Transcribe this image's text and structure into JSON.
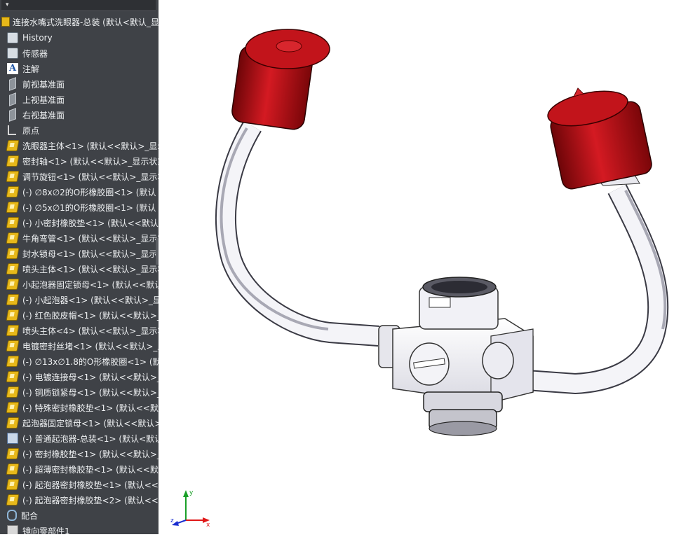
{
  "feature_tree": {
    "root_label": "连接水嘴式洗眼器-总装 (默认<默认_显示",
    "items": [
      {
        "label": "History",
        "icon": "history-icon"
      },
      {
        "label": "传感器",
        "icon": "sensor-icon"
      },
      {
        "label": "注解",
        "icon": "annotation-icon"
      },
      {
        "label": "前视基准面",
        "icon": "plane-icon"
      },
      {
        "label": "上视基准面",
        "icon": "plane-icon"
      },
      {
        "label": "右视基准面",
        "icon": "plane-icon"
      },
      {
        "label": "原点",
        "icon": "origin-icon"
      },
      {
        "label": "洗眼器主体<1> (默认<<默认>_显示",
        "icon": "part-icon"
      },
      {
        "label": "密封轴<1> (默认<<默认>_显示状态",
        "icon": "part-icon"
      },
      {
        "label": "调节旋钮<1> (默认<<默认>_显示状",
        "icon": "part-icon"
      },
      {
        "label": "(-) ∅8x∅2的O形橡胶圈<1> (默认",
        "icon": "part-icon"
      },
      {
        "label": "(-) ∅5x∅1的O形橡胶圈<1> (默认",
        "icon": "part-icon"
      },
      {
        "label": "(-) 小密封橡胶垫<1> (默认<<默认",
        "icon": "part-icon"
      },
      {
        "label": "牛角弯管<1> (默认<<默认>_显示状",
        "icon": "part-icon"
      },
      {
        "label": "封水锁母<1> (默认<<默认>_显示状",
        "icon": "part-icon"
      },
      {
        "label": "喷头主体<1> (默认<<默认>_显示状",
        "icon": "part-icon"
      },
      {
        "label": "小起泡器固定锁母<1> (默认<<默认",
        "icon": "part-icon"
      },
      {
        "label": "(-) 小起泡器<1> (默认<<默认>_显",
        "icon": "part-icon"
      },
      {
        "label": "(-) 红色胶皮帽<1> (默认<<默认>_",
        "icon": "part-icon"
      },
      {
        "label": "喷头主体<4> (默认<<默认>_显示状",
        "icon": "part-icon"
      },
      {
        "label": "电镀密封丝堵<1> (默认<<默认>_显",
        "icon": "part-icon"
      },
      {
        "label": "(-) ∅13x∅1.8的O形橡胶圈<1> (默",
        "icon": "part-icon"
      },
      {
        "label": "(-) 电镀连接母<1> (默认<<默认>_",
        "icon": "part-icon"
      },
      {
        "label": "(-) 铜质锁紧母<1> (默认<<默认>_",
        "icon": "part-icon"
      },
      {
        "label": "(-) 特殊密封橡胶垫<1> (默认<<默",
        "icon": "part-icon"
      },
      {
        "label": "起泡器固定锁母<1> (默认<<默认>_",
        "icon": "part-icon"
      },
      {
        "label": "(-) 普通起泡器-总装<1> (默认<默认",
        "icon": "assembly-icon"
      },
      {
        "label": "(-) 密封橡胶垫<1> (默认<<默认>_",
        "icon": "part-icon"
      },
      {
        "label": "(-) 超薄密封橡胶垫<1> (默认<<默",
        "icon": "part-icon"
      },
      {
        "label": "(-) 起泡器密封橡胶垫<1> (默认<<默",
        "icon": "part-icon"
      },
      {
        "label": "(-) 起泡器密封橡胶垫<2> (默认<<默",
        "icon": "part-icon"
      },
      {
        "label": "配合",
        "icon": "mates-icon"
      },
      {
        "label": "镜向零部件1",
        "icon": "mirror-icon"
      }
    ]
  },
  "triad": {
    "x_label": "x",
    "y_label": "y",
    "z_label": "z"
  },
  "colors": {
    "panel_bg": "#3f4247",
    "cap_red": "#c0141c",
    "triad_x": "#e01818",
    "triad_y": "#1aa028",
    "triad_z": "#1a2ed0"
  }
}
